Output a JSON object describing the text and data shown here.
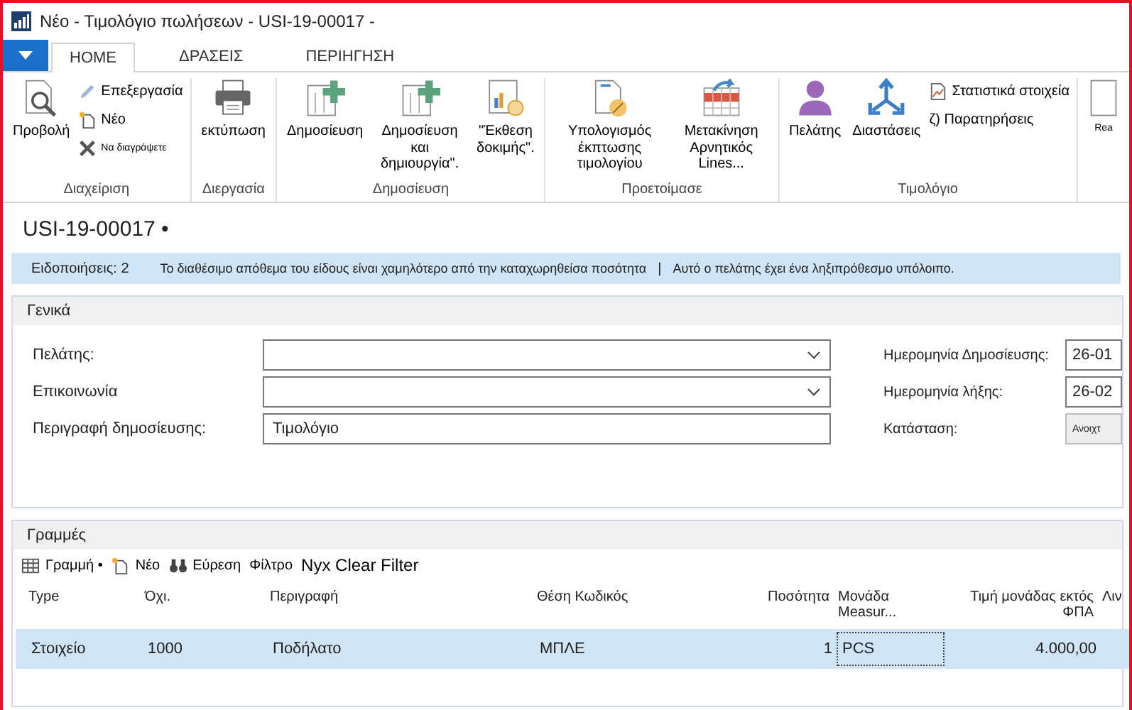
{
  "window": {
    "title": "Νέο - Τιμολόγιο πωλήσεων - USI-19-00017 -"
  },
  "tabs": [
    {
      "label": "HOME",
      "selected": true
    },
    {
      "label": "ΔΡΑΣΕΙΣ",
      "selected": false
    },
    {
      "label": "ΠΕΡΙΗΓΗΣΗ",
      "selected": false
    }
  ],
  "ribbon": [
    {
      "name": "Διαχείριση",
      "items": [
        {
          "kind": "large",
          "label": "Προβολή"
        },
        {
          "kind": "small",
          "label": "Επεξεργασία"
        },
        {
          "kind": "small",
          "label": "Νέο"
        },
        {
          "kind": "small",
          "label": "Να διαγράψετε"
        }
      ]
    },
    {
      "name": "Διεργασία",
      "items": [
        {
          "kind": "large",
          "label": "εκτύπωση"
        }
      ]
    },
    {
      "name": "Δημοσίευση",
      "items": [
        {
          "kind": "large",
          "label": "Δημοσίευση"
        },
        {
          "kind": "large",
          "label": "Δημοσίευση και δημιουργία\"."
        },
        {
          "kind": "large",
          "label": "\"Έκθεση δοκιμής\"."
        }
      ]
    },
    {
      "name": "Προετοίμασε",
      "items": [
        {
          "kind": "large",
          "label": "Υπολογισμός έκπτωσης τιμολογίου"
        },
        {
          "kind": "large",
          "label": "Μετακίνηση Αρνητικός Lines..."
        }
      ]
    },
    {
      "name": "Τιμολόγιο",
      "items": [
        {
          "kind": "large",
          "label": "Πελάτης"
        },
        {
          "kind": "large",
          "label": "Διαστάσεις"
        },
        {
          "kind": "small",
          "label": "Στατιστικά στοιχεία"
        },
        {
          "kind": "small",
          "label": "ζ) Παρατηρήσεις"
        }
      ]
    },
    {
      "items": [
        {
          "kind": "large",
          "label": "Rea"
        }
      ]
    }
  ],
  "page_title": "USI-19-00017 •",
  "notifications": {
    "label": "Ειδοποιήσεις: 2",
    "separator": "|",
    "messages": [
      "Το διαθέσιμο απόθεμα του είδους είναι χαμηλότερο από την καταχωρηθείσα ποσότητα",
      "Αυτό ο πελάτης έχει ένα ληξιπρόθεσμο υπόλοιπο."
    ]
  },
  "general": {
    "title": "Γενικά",
    "left_fields": [
      {
        "label": "Πελάτης:",
        "kind": "dropdown"
      },
      {
        "label": "Επικοινωνία",
        "kind": "dropdown"
      },
      {
        "label": "Περιγραφή δημοσίευσης:",
        "kind": "text",
        "value": "Τιμολόγιο"
      }
    ],
    "right_fields": [
      {
        "label": "Ημερομηνία Δημοσίευσης:",
        "value": "26-01",
        "kind": "text"
      },
      {
        "label": "Ημερομηνία λήξης:",
        "value": "26-02",
        "kind": "text"
      },
      {
        "label": "Κατάσταση:",
        "value": "Ανοιχτ",
        "kind": "status"
      }
    ]
  },
  "lines": {
    "title": "Γραμμές",
    "toolbar": [
      {
        "label": "Γραμμή •"
      },
      {
        "label": "Νέο"
      },
      {
        "label": "Εύρεση"
      },
      {
        "label": "Φίλτρο"
      },
      {
        "label": "Nyx Clear Filter"
      }
    ],
    "columns": [
      "Type",
      "Όχι.",
      "Περιγραφή",
      "Θέση Κωδικός",
      "Ποσότητα",
      "Μονάδα Measur...",
      "Τιμή μονάδας εκτός ΦΠΑ",
      "Λιν"
    ],
    "rows": [
      {
        "selected": true,
        "cells": [
          "Στοιχείο",
          "1000",
          "Ποδήλατο",
          "ΜΠΛΕ",
          "1",
          "PCS",
          "4.000,00",
          ""
        ]
      }
    ]
  }
}
